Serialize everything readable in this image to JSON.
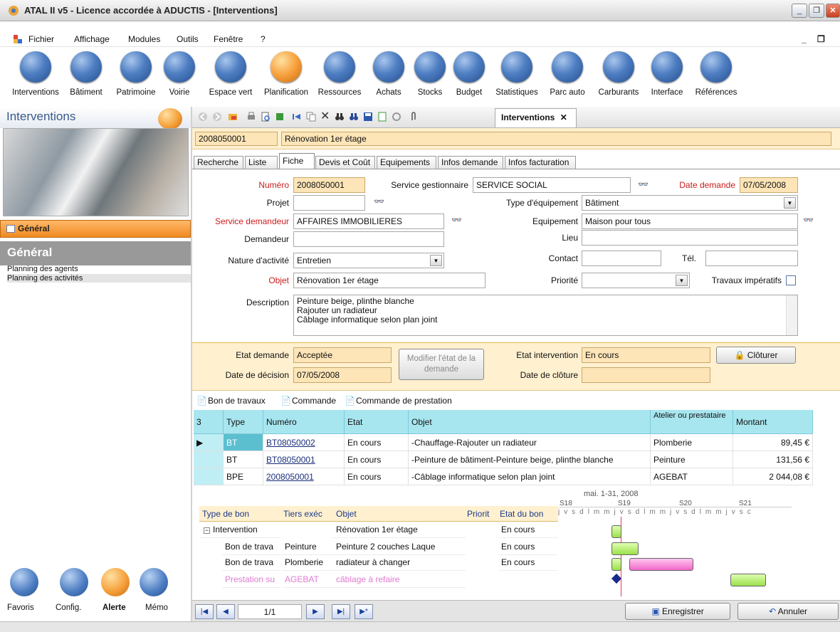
{
  "window": {
    "title": "ATAL II v5 - Licence accordée à ADUCTIS - [Interventions]"
  },
  "menu": [
    "Fichier",
    "Affichage",
    "Modules",
    "Outils",
    "Fenêtre",
    "?"
  ],
  "modules": [
    {
      "label": "Interventions",
      "icon": "interventions-icon"
    },
    {
      "label": "Bâtiment",
      "icon": "building-icon"
    },
    {
      "label": "Patrimoine",
      "icon": "heritage-icon"
    },
    {
      "label": "Voirie",
      "icon": "road-icon"
    },
    {
      "label": "Espace vert",
      "icon": "leaf-icon"
    },
    {
      "label": "Planification",
      "icon": "planning-icon"
    },
    {
      "label": "Ressources",
      "icon": "person-icon"
    },
    {
      "label": "Achats",
      "icon": "card-icon"
    },
    {
      "label": "Stocks",
      "icon": "bulb-icon"
    },
    {
      "label": "Budget",
      "icon": "euro-icon"
    },
    {
      "label": "Statistiques",
      "icon": "stats-icon"
    },
    {
      "label": "Parc auto",
      "icon": "truck-icon"
    },
    {
      "label": "Carburants",
      "icon": "fuel-icon"
    },
    {
      "label": "Interface",
      "icon": "network-icon"
    },
    {
      "label": "Références",
      "icon": "book-icon"
    }
  ],
  "left": {
    "header": "Interventions",
    "section_button": "Général",
    "section_title": "Général",
    "links": [
      "Planning des agents",
      "Planning des activités"
    ],
    "bottom": [
      {
        "label": "Favoris",
        "icon": "star-icon"
      },
      {
        "label": "Config.",
        "icon": "gears-icon"
      },
      {
        "label": "Alerte",
        "icon": "clock-icon"
      },
      {
        "label": "Mémo",
        "icon": "memo-icon"
      }
    ]
  },
  "doc_tab": {
    "label": "Interventions",
    "close": "✕"
  },
  "record": {
    "numero": "2008050001",
    "libelle": "Rénovation 1er étage"
  },
  "tabs": [
    "Recherche",
    "Liste",
    "Fiche",
    "Devis et Coût",
    "Equipements",
    "Infos demande",
    "Infos facturation"
  ],
  "form": {
    "numero_label": "Numéro",
    "numero": "2008050001",
    "service_gest_label": "Service gestionnaire",
    "service_gest": "SERVICE SOCIAL",
    "date_demande_label": "Date demande",
    "date_demande": "07/05/2008",
    "projet_label": "Projet",
    "projet": "",
    "type_equip_label": "Type d'équipement",
    "type_equip": "Bâtiment",
    "service_dem_label": "Service demandeur",
    "service_dem": "AFFAIRES IMMOBILIERES",
    "equipement_label": "Equipement",
    "equipement": "Maison pour tous",
    "demandeur_label": "Demandeur",
    "demandeur": "",
    "lieu_label": "Lieu",
    "lieu": "",
    "nature_label": "Nature d'activité",
    "nature": "Entretien",
    "contact_label": "Contact",
    "contact": "",
    "tel_label": "Tél.",
    "tel": "",
    "objet_label": "Objet",
    "objet": "Rénovation 1er étage",
    "priorite_label": "Priorité",
    "priorite": "",
    "travaux_label": "Travaux impératifs",
    "description_label": "Description",
    "description": [
      "Peinture beige, plinthe blanche",
      "Rajouter un radiateur",
      "Câblage informatique selon plan joint"
    ]
  },
  "etat": {
    "etat_demande_label": "Etat demande",
    "etat_demande": "Acceptée",
    "date_decision_label": "Date de décision",
    "date_decision": "07/05/2008",
    "modifier_label_1": "Modifier l'état de la",
    "modifier_label_2": "demande",
    "etat_intervention_label": "Etat intervention",
    "etat_intervention": "En cours",
    "date_cloture_label": "Date de clôture",
    "date_cloture": "",
    "cloturer_label": "Clôturer"
  },
  "links": [
    "Bon de travaux",
    "Commande",
    "Commande de prestation"
  ],
  "grid": {
    "count": "3",
    "headers": [
      "Type",
      "Numéro",
      "Etat",
      "Objet",
      "Atelier ou prestataire",
      "Montant"
    ],
    "rows": [
      {
        "type": "BT",
        "numero": "BT08050002",
        "etat": "En cours",
        "objet": "-Chauffage-Rajouter un radiateur",
        "atelier": "Plomberie",
        "montant": "89,45 €"
      },
      {
        "type": "BT",
        "numero": "BT08050001",
        "etat": "En cours",
        "objet": "-Peinture de bâtiment-Peinture beige, plinthe blanche",
        "atelier": "Peinture",
        "montant": "131,56 €"
      },
      {
        "type": "BPE",
        "numero": "2008050001",
        "etat": "En cours",
        "objet": "-Câblage informatique selon plan joint",
        "atelier": "AGEBAT",
        "montant": "2 044,08 €"
      }
    ]
  },
  "gantt": {
    "period": "mai. 1-31, 2008",
    "weeks": [
      "S18",
      "S19",
      "S20",
      "S21"
    ],
    "days": "j v s d l m m j v s d l m m j v s d l m m j v s c",
    "headers": [
      "Type de bon",
      "Tiers exéc",
      "Objet",
      "Priorit",
      "Etat du bon"
    ],
    "rows": [
      {
        "type": "Intervention",
        "tiers": "",
        "objet": "Rénovation 1er étage",
        "prio": "",
        "etat": "En cours"
      },
      {
        "type": "Bon de trava",
        "tiers": "Peinture",
        "objet": "Peinture 2 couches Laque",
        "prio": "",
        "etat": "En cours"
      },
      {
        "type": "Bon de trava",
        "tiers": "Plomberie",
        "objet": "radiateur à changer",
        "prio": "",
        "etat": "En cours"
      },
      {
        "type": "Prestation su",
        "tiers": "AGEBAT",
        "objet": "câblage à refaire",
        "prio": "",
        "etat": ""
      }
    ]
  },
  "bottom": {
    "page": "1/1",
    "save": "Enregistrer",
    "cancel": "Annuler"
  }
}
